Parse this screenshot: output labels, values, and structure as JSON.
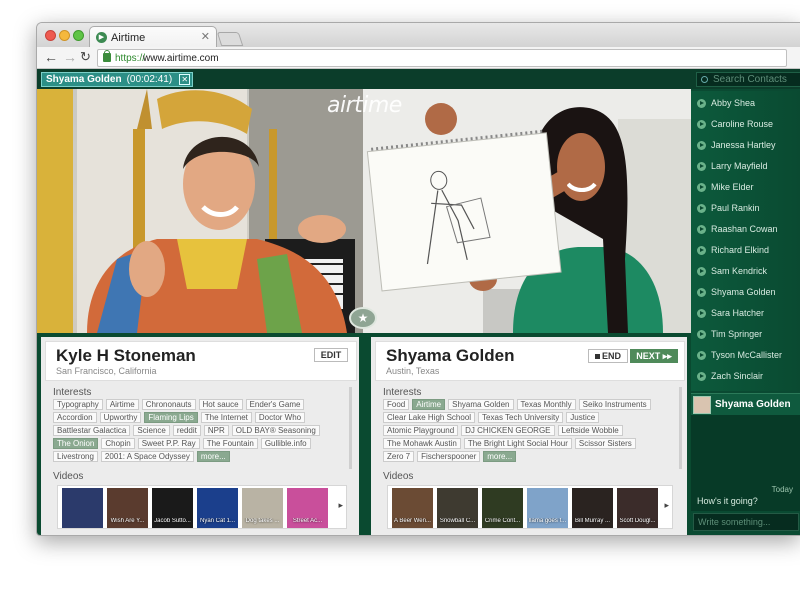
{
  "browser": {
    "tab_title": "Airtime",
    "url_scheme": "https://",
    "url_host": "www.airtime.com"
  },
  "call": {
    "name": "Shyama Golden",
    "timer": "(00:02:41)"
  },
  "search": {
    "placeholder": "Search Contacts"
  },
  "logo": "airtime",
  "left_profile": {
    "name": "Kyle H Stoneman",
    "location": "San Francisco, California",
    "edit_label": "EDIT",
    "interests_label": "Interests",
    "interests": [
      {
        "label": "Typography",
        "selected": false
      },
      {
        "label": "Airtime",
        "selected": false
      },
      {
        "label": "Chrononauts",
        "selected": false
      },
      {
        "label": "Hot sauce",
        "selected": false
      },
      {
        "label": "Ender's Game",
        "selected": false
      },
      {
        "label": "Accordion",
        "selected": false
      },
      {
        "label": "Upworthy",
        "selected": false
      },
      {
        "label": "Flaming Lips",
        "selected": true
      },
      {
        "label": "The Internet",
        "selected": false
      },
      {
        "label": "Doctor Who",
        "selected": false
      },
      {
        "label": "Battlestar Galactica",
        "selected": false
      },
      {
        "label": "Science",
        "selected": false
      },
      {
        "label": "reddit",
        "selected": false
      },
      {
        "label": "NPR",
        "selected": false
      },
      {
        "label": "OLD BAY® Seasoning",
        "selected": false
      },
      {
        "label": "The Onion",
        "selected": true
      },
      {
        "label": "Chopin",
        "selected": false
      },
      {
        "label": "Sweet P.P. Ray",
        "selected": false
      },
      {
        "label": "The Fountain",
        "selected": false
      },
      {
        "label": "Gullible.info",
        "selected": false
      },
      {
        "label": "Livestrong",
        "selected": false
      },
      {
        "label": "2001: A Space Odyssey",
        "selected": false
      }
    ],
    "more_label": "more...",
    "videos_label": "Videos",
    "videos": [
      {
        "title": "",
        "color": "#2b3a6b"
      },
      {
        "title": "Wish Are Y...",
        "color": "#5a3b2e"
      },
      {
        "title": "Jacob Sutto...",
        "color": "#1a1a1a"
      },
      {
        "title": "Nyan Cat 1...",
        "color": "#1b3f8c"
      },
      {
        "title": "Dog takes ...",
        "color": "#b9b3a4"
      },
      {
        "title": "Street Ac...",
        "color": "#c94f9b"
      }
    ]
  },
  "right_profile": {
    "name": "Shyama Golden",
    "location": "Austin, Texas",
    "end_label": "END",
    "next_label": "NEXT ▸▸",
    "interests_label": "Interests",
    "interests": [
      {
        "label": "Food",
        "selected": false
      },
      {
        "label": "Airtime",
        "selected": true
      },
      {
        "label": "Shyama Golden",
        "selected": false
      },
      {
        "label": "Texas Monthly",
        "selected": false
      },
      {
        "label": "Seiko Instruments",
        "selected": false
      },
      {
        "label": "Clear Lake High School",
        "selected": false
      },
      {
        "label": "Texas Tech University",
        "selected": false
      },
      {
        "label": "Justice",
        "selected": false
      },
      {
        "label": "Atomic Playground",
        "selected": false
      },
      {
        "label": "DJ CHICKEN GEORGE",
        "selected": false
      },
      {
        "label": "Leftside Wobble",
        "selected": false
      },
      {
        "label": "The Mohawk Austin",
        "selected": false
      },
      {
        "label": "The Bright Light Social Hour",
        "selected": false
      },
      {
        "label": "Scissor Sisters",
        "selected": false
      },
      {
        "label": "Zero 7",
        "selected": false
      },
      {
        "label": "Fischerspooner",
        "selected": false
      }
    ],
    "more_label": "more...",
    "videos_label": "Videos",
    "videos": [
      {
        "title": "A Beer Wen...",
        "color": "#6b4b34"
      },
      {
        "title": "Snowball C...",
        "color": "#3e3a30"
      },
      {
        "title": "Crime Cont...",
        "color": "#2f3b22"
      },
      {
        "title": "llama goes f...",
        "color": "#7fa3c9"
      },
      {
        "title": "Bill Murray ...",
        "color": "#2a2320"
      },
      {
        "title": "Scott Dougl...",
        "color": "#3b2c2a"
      }
    ]
  },
  "contacts": [
    "Abby Shea",
    "Caroline Rouse",
    "Janessa Hartley",
    "Larry Mayfield",
    "Mike Elder",
    "Paul Rankin",
    "Raashan Cowan",
    "Richard Elkind",
    "Sam Kendrick",
    "Shyama Golden",
    "Sara Hatcher",
    "Tim Springer",
    "Tyson McCallister",
    "Zach Sinclair"
  ],
  "chat": {
    "contact_name": "Shyama Golden",
    "time": "Today",
    "message": "How's it going?",
    "input_placeholder": "Write something..."
  }
}
